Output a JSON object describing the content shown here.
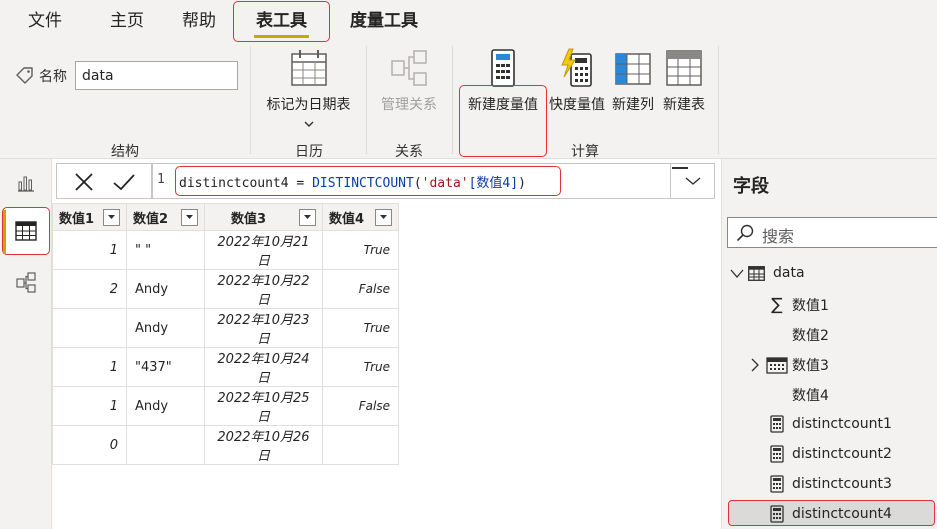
{
  "tabs": [
    {
      "label": "文件"
    },
    {
      "label": "主页"
    },
    {
      "label": "帮助"
    },
    {
      "label": "表工具"
    },
    {
      "label": "度量工具"
    }
  ],
  "ribbon": {
    "name_label": "名称",
    "name_value": "data",
    "mark_date_table": "标记为日期表",
    "manage_relations": "管理关系",
    "new_measure": "新建度量值",
    "quick_measure": "快度量值",
    "new_column": "新建列",
    "new_table": "新建表",
    "groups": {
      "structure": "结构",
      "calendar": "日历",
      "relations": "关系",
      "calc": "计算"
    }
  },
  "formula": {
    "line_no": "1",
    "lhs": "distinctcount4 = ",
    "fn": "DISTINCTCOUNT",
    "open": "(",
    "table": "'data'",
    "column": "[数值4]",
    "close": ")"
  },
  "table": {
    "headers": [
      "数值1",
      "数值2",
      "数值3",
      "数值4"
    ],
    "rows": [
      [
        "1",
        "\" \"",
        "2022年10月21日",
        "True"
      ],
      [
        "2",
        "Andy",
        "2022年10月22日",
        "False"
      ],
      [
        "",
        "Andy",
        "2022年10月23日",
        "True"
      ],
      [
        "1",
        "\"437\"",
        "2022年10月24日",
        "True"
      ],
      [
        "1",
        "Andy",
        "2022年10月25日",
        "False"
      ],
      [
        "0",
        "",
        "2022年10月26日",
        ""
      ]
    ]
  },
  "fields": {
    "title": "字段",
    "search_placeholder": "搜索",
    "table_name": "data",
    "items": [
      {
        "label": "数值1",
        "icon": "sigma-icon"
      },
      {
        "label": "数值2",
        "icon": ""
      },
      {
        "label": "数值3",
        "icon": "calendar-icon"
      },
      {
        "label": "数值4",
        "icon": ""
      },
      {
        "label": "distinctcount1",
        "icon": "calculator-icon"
      },
      {
        "label": "distinctcount2",
        "icon": "calculator-icon"
      },
      {
        "label": "distinctcount3",
        "icon": "calculator-icon"
      },
      {
        "label": "distinctcount4",
        "icon": "calculator-icon"
      }
    ]
  },
  "colors": {
    "accent": "#c8a700",
    "highlight": "#e0313a",
    "chrome": "#f3f2f1"
  }
}
